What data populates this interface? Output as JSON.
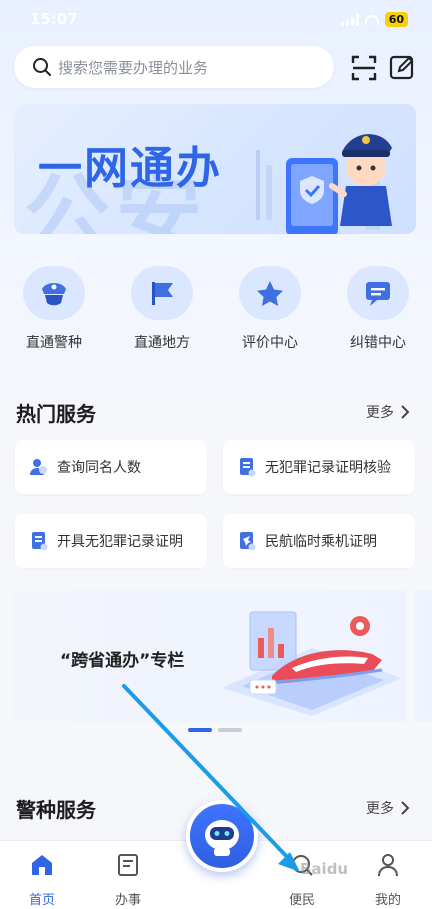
{
  "status_bar": {
    "time": "15:07",
    "battery": "60"
  },
  "search": {
    "placeholder": "搜索您需要办理的业务"
  },
  "banner": {
    "title": "一网通办",
    "bg_text": "公安"
  },
  "quick_entries": [
    {
      "label": "直通警种",
      "icon": "police-cap-icon"
    },
    {
      "label": "直通地方",
      "icon": "flag-icon"
    },
    {
      "label": "评价中心",
      "icon": "star-icon"
    },
    {
      "label": "纠错中心",
      "icon": "message-icon"
    }
  ],
  "hot_services": {
    "title": "热门服务",
    "more": "更多",
    "items": [
      {
        "label": "查询同名人数",
        "icon": "people-icon"
      },
      {
        "label": "无犯罪记录证明核验",
        "icon": "document-icon"
      },
      {
        "label": "开具无犯罪记录证明",
        "icon": "document-icon"
      },
      {
        "label": "民航临时乘机证明",
        "icon": "plane-document-icon"
      }
    ]
  },
  "promo": {
    "title": "“跨省通办”专栏"
  },
  "police_services": {
    "title": "警种服务",
    "more": "更多"
  },
  "bottom_nav": [
    {
      "label": "首页",
      "icon": "home-icon",
      "active": true
    },
    {
      "label": "办事",
      "icon": "task-icon"
    },
    {
      "label": "便民",
      "icon": "convenience-icon"
    },
    {
      "label": "我的",
      "icon": "user-icon"
    }
  ],
  "watermark": "Baidu",
  "colors": {
    "accent": "#2f66e8",
    "icon_bg": "#dbe7ff",
    "arrow": "#1e9be8"
  }
}
